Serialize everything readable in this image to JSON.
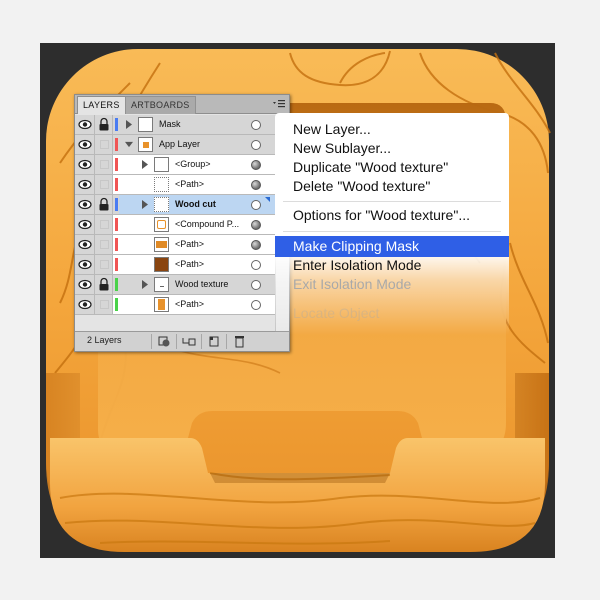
{
  "layers_panel": {
    "tabs": [
      {
        "label": "LAYERS"
      },
      {
        "label": "ARTBOARDS"
      }
    ],
    "layers": [
      {
        "name": "Mask",
        "bar_color": "#4a7cf2"
      },
      {
        "name": "App Layer",
        "bar_color": "#f05555"
      },
      {
        "name": "<Group>",
        "bar_color": "#f05555"
      },
      {
        "name": "<Path>",
        "bar_color": "#f05555"
      },
      {
        "name": "Wood cut",
        "bar_color": "#4a7cf2"
      },
      {
        "name": "<Compound P...",
        "bar_color": "#f05555"
      },
      {
        "name": "<Path>",
        "bar_color": "#f05555"
      },
      {
        "name": "<Path>",
        "bar_color": "#f05555"
      },
      {
        "name": "Wood texture",
        "bar_color": "#4ad24a"
      },
      {
        "name": "<Path>",
        "bar_color": "#4ad24a"
      }
    ],
    "footer": {
      "count": "2 Layers"
    }
  },
  "context_menu": {
    "items": [
      {
        "label": "New Layer...",
        "state": "normal"
      },
      {
        "label": "New Sublayer...",
        "state": "normal"
      },
      {
        "label": "Duplicate \"Wood texture\"",
        "state": "normal"
      },
      {
        "label": "Delete \"Wood texture\"",
        "state": "normal"
      },
      {
        "label": "Options for \"Wood texture\"...",
        "state": "normal"
      },
      {
        "label": "Make Clipping Mask",
        "state": "highlighted"
      },
      {
        "label": "Enter Isolation Mode",
        "state": "normal"
      },
      {
        "label": "Exit Isolation Mode",
        "state": "disabled"
      },
      {
        "label": "Locate Object",
        "state": "disabled"
      }
    ]
  },
  "colors": {
    "wood_light": "#f7b34f",
    "wood_dark": "#c9760d",
    "wood_grain": "#b5630a",
    "menu_highlight": "#2f5fe6",
    "selected_row": "#bcd6f2"
  }
}
